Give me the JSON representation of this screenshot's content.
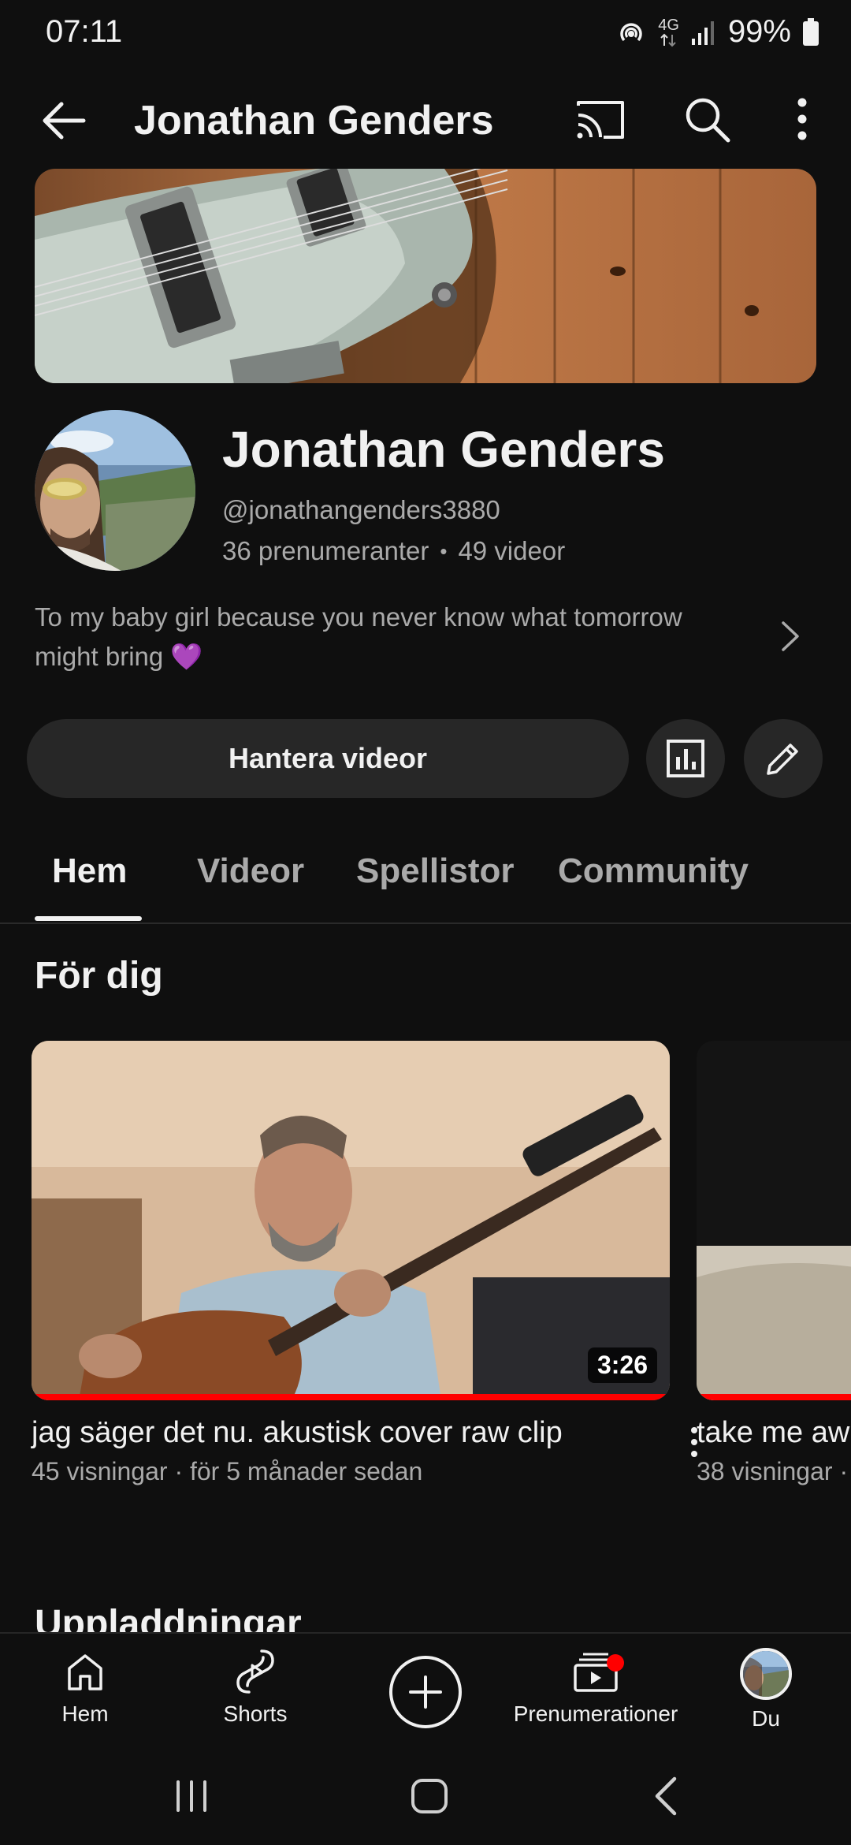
{
  "status_bar": {
    "time": "07:11",
    "network": "4G",
    "battery": "99%"
  },
  "top_bar": {
    "title": "Jonathan Genders"
  },
  "channel": {
    "name": "Jonathan Genders",
    "handle": "@jonathangenders3880",
    "subscribers": "36 prenumeranter",
    "videos": "49 videor",
    "description": "To my baby girl because you never know what tomorrow might bring 💜"
  },
  "actions": {
    "manage_label": "Hantera videor"
  },
  "tabs": [
    {
      "label": "Hem",
      "active": true
    },
    {
      "label": "Videor",
      "active": false
    },
    {
      "label": "Spellistor",
      "active": false
    },
    {
      "label": "Community",
      "active": false
    }
  ],
  "sections": {
    "for_you_title": "För dig",
    "uploads_title": "Uppladdningar"
  },
  "videos": [
    {
      "title": "jag säger det nu. akustisk cover raw clip",
      "meta": "45 visningar · för 5 månader sedan",
      "duration": "3:26",
      "progress": 1.0
    },
    {
      "title": "take me aw",
      "meta": "38 visningar ·",
      "progress": 1.0
    }
  ],
  "bottom_nav": [
    {
      "label": "Hem",
      "icon": "home-icon"
    },
    {
      "label": "Shorts",
      "icon": "shorts-icon"
    },
    {
      "label": "",
      "icon": "create-icon"
    },
    {
      "label": "Prenumerationer",
      "icon": "subscriptions-icon"
    },
    {
      "label": "Du",
      "icon": "avatar"
    }
  ],
  "colors": {
    "background": "#0f0f0f",
    "accent": "#ff0000",
    "surface": "#272727",
    "secondary_text": "#aaaaaa"
  }
}
